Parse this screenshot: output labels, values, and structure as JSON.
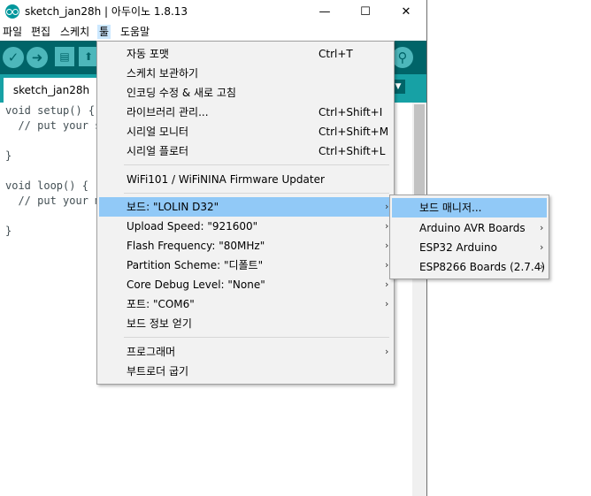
{
  "window": {
    "title": "sketch_jan28h | 아두이노 1.8.13",
    "minimize_glyph": "—",
    "maximize_glyph": "☐",
    "close_glyph": "✕"
  },
  "menubar": {
    "items": [
      "파일",
      "편집",
      "스케치",
      "툴",
      "도움말"
    ]
  },
  "toolbar": {
    "verify_glyph": "✓",
    "upload_glyph": "➜",
    "new_glyph": "▤",
    "open_glyph": "⬆",
    "serial_glyph": "⚲"
  },
  "tab": {
    "label": "sketch_jan28h",
    "menu_glyph": "▼"
  },
  "code": [
    "void setup() {",
    "  // put your s",
    "",
    "}",
    "",
    "void loop() {",
    "  // put your m",
    "",
    "}"
  ],
  "tools_menu": {
    "items": [
      {
        "label": "자동 포맷",
        "shortcut": "Ctrl+T"
      },
      {
        "label": "스케치 보관하기",
        "shortcut": ""
      },
      {
        "label": "인코딩 수정 & 새로 고침",
        "shortcut": ""
      },
      {
        "label": "라이브러리 관리...",
        "shortcut": "Ctrl+Shift+I"
      },
      {
        "label": "시리얼 모니터",
        "shortcut": "Ctrl+Shift+M"
      },
      {
        "label": "시리얼 플로터",
        "shortcut": "Ctrl+Shift+L"
      },
      {
        "label": "WiFi101 / WiFiNINA Firmware Updater",
        "shortcut": ""
      },
      {
        "label": "보드: \"LOLIN D32\"",
        "shortcut": ""
      },
      {
        "label": "Upload Speed: \"921600\"",
        "shortcut": ""
      },
      {
        "label": "Flash Frequency: \"80MHz\"",
        "shortcut": ""
      },
      {
        "label": "Partition Scheme: \"디폴트\"",
        "shortcut": ""
      },
      {
        "label": "Core Debug Level: \"None\"",
        "shortcut": ""
      },
      {
        "label": "포트: \"COM6\"",
        "shortcut": ""
      },
      {
        "label": "보드 정보 얻기",
        "shortcut": ""
      },
      {
        "label": "프로그래머",
        "shortcut": ""
      },
      {
        "label": "부트로더 굽기",
        "shortcut": ""
      }
    ],
    "submenu_arrow": "›"
  },
  "board_submenu": {
    "items": [
      {
        "label": "보드 매니저..."
      },
      {
        "label": "Arduino AVR Boards"
      },
      {
        "label": "ESP32 Arduino"
      },
      {
        "label": "ESP8266 Boards (2.7.4)"
      }
    ]
  },
  "colors": {
    "toolbar": "#006468",
    "tabbar": "#17a1a5",
    "highlight": "#91c9f7",
    "active_menu": "#cce8ff"
  }
}
